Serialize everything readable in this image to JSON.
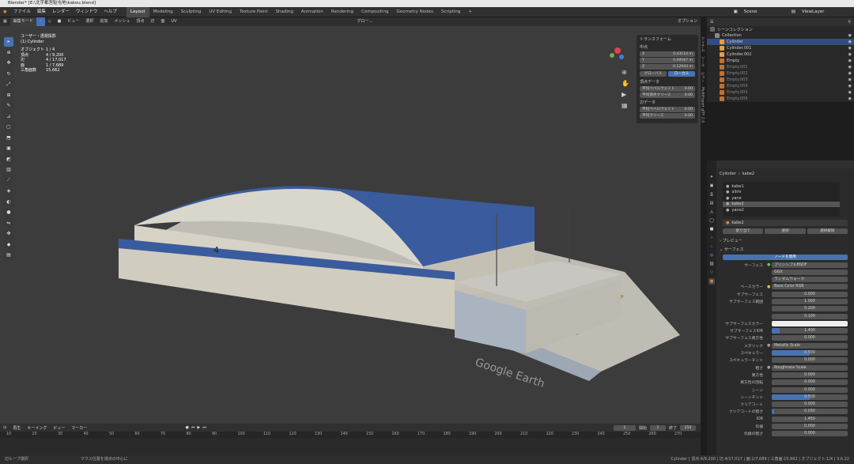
{
  "window": {
    "title": "Blender* [E:\\北宇都宮駐屯地\\kakou.blend]"
  },
  "menu": [
    "ファイル",
    "編集",
    "レンダー",
    "ウィンドウ",
    "ヘルプ"
  ],
  "workspaces": [
    "Layout",
    "Modeling",
    "Sculpting",
    "UV Editing",
    "Texture Paint",
    "Shading",
    "Animation",
    "Rendering",
    "Compositing",
    "Geometry Nodes",
    "Scripting"
  ],
  "active_workspace": "Layout",
  "scene": {
    "name": "Scene",
    "view_layer": "ViewLayer"
  },
  "viewport_header": {
    "mode": "編集モード",
    "menus": [
      "ビュー",
      "選択",
      "追加",
      "メッシュ",
      "頂点",
      "辺",
      "面",
      "UV"
    ],
    "transform": "グロー...",
    "options": "オプション"
  },
  "overlay_info": {
    "view": "ユーザー・透視投影",
    "object": "(1) Cylinder",
    "stats": [
      {
        "k": "オブジェクト",
        "v": "1 / 4"
      },
      {
        "k": "頂点",
        "v": "4 / 9,200"
      },
      {
        "k": "辺",
        "v": "4 / 17,017"
      },
      {
        "k": "面",
        "v": "1 / 7,689"
      },
      {
        "k": "三角面数",
        "v": "15,662"
      }
    ]
  },
  "n_panel": {
    "title": "トランスフォーム",
    "median": "中点",
    "x": {
      "label": "X",
      "value": "0.43114 m"
    },
    "y": {
      "label": "Y",
      "value": "0.09567 m"
    },
    "z": {
      "label": "Z",
      "value": "0.12943 m"
    },
    "global": "グローバル",
    "local": "ローカル",
    "vertex_data": "頂点データ",
    "bevel_weight_label": "平均ベベルウェイト",
    "bevel_weight": "0.00",
    "crease_label": "平均頂点クリース",
    "crease": "0.00",
    "edge_data": "辺データ",
    "edge_bevel_label": "平均ベベルウェイト",
    "edge_bevel": "0.00",
    "edge_crease_label": "平均クリース",
    "edge_crease": "0.00"
  },
  "side_tabs": [
    "アイテム",
    "ツール",
    "ビュー",
    "MultiExport glTF 2.0"
  ],
  "outliner": {
    "title": "シーンコレクション",
    "items": [
      {
        "name": "Collection",
        "color": "#888888"
      },
      {
        "name": "Cylinder",
        "color": "#e0a040"
      },
      {
        "name": "Cylinder.001",
        "color": "#e0a040"
      },
      {
        "name": "Cylinder.002",
        "color": "#e0a040"
      },
      {
        "name": "Empty",
        "color": "#c07030"
      },
      {
        "name": "Empty.001",
        "color": "#c07030"
      },
      {
        "name": "Empty.002",
        "color": "#c07030"
      },
      {
        "name": "Empty.003",
        "color": "#c07030"
      },
      {
        "name": "Empty.004",
        "color": "#c07030"
      },
      {
        "name": "Empty.005",
        "color": "#c07030"
      },
      {
        "name": "Empty.006",
        "color": "#c07030"
      }
    ]
  },
  "properties": {
    "breadcrumb_object": "Cylinder",
    "breadcrumb_material": "kabe2",
    "slots": [
      "kabe1",
      "alimi",
      "yane",
      "kabe2",
      "yane2"
    ],
    "active_slot": "kabe2",
    "material_name": "kabe2",
    "assign": "割り当て",
    "select": "選択",
    "deselect": "選択解除",
    "preview": "プレビュー",
    "surface_panel": "サーフェス",
    "use_nodes": "ノードを使用",
    "rows": [
      {
        "label": "サーフェス",
        "value": "プリンシプルBSDF",
        "dot": "#5ec35e"
      },
      {
        "label": "",
        "value": "GGX"
      },
      {
        "label": "",
        "value": "ランダムウォーク"
      },
      {
        "label": "ベースカラー",
        "value": "Base Color RGB",
        "dot": "#e0c040"
      },
      {
        "label": "サブサーフェス",
        "value": "0.000"
      },
      {
        "label": "サブサーフェス範囲",
        "value": "1.000"
      },
      {
        "label": "",
        "value": "0.200"
      },
      {
        "label": "",
        "value": "0.100"
      },
      {
        "label": "サブサーフェスカラー",
        "value": "",
        "swatch": "#eeeeee"
      },
      {
        "label": "サブサーフェスIOR",
        "value": "1.400",
        "fill": 0.1
      },
      {
        "label": "サブサーフェス異方性",
        "value": "0.000"
      },
      {
        "label": "メタリック",
        "value": "Metallic Scale",
        "dot": "#a0a0a0"
      },
      {
        "label": "スペキュラー",
        "value": "0.500",
        "fill": 0.5
      },
      {
        "label": "スペキュラーチント",
        "value": "0.000"
      },
      {
        "label": "粗さ",
        "value": "Roughness Scale",
        "dot": "#a0a0a0"
      },
      {
        "label": "異方性",
        "value": "0.000"
      },
      {
        "label": "異方性の回転",
        "value": "0.000"
      },
      {
        "label": "シーン",
        "value": "0.000"
      },
      {
        "label": "シーンチント",
        "value": "0.500",
        "fill": 0.5
      },
      {
        "label": "クリアコート",
        "value": "0.000"
      },
      {
        "label": "クリアコートの粗さ",
        "value": "0.030",
        "fill": 0.03
      },
      {
        "label": "IOR",
        "value": "1.450"
      },
      {
        "label": "伝播",
        "value": "0.000"
      },
      {
        "label": "伝播の粗さ",
        "value": "0.000"
      }
    ]
  },
  "timeline": {
    "menus": [
      "再生",
      "キーイング",
      "ビュー",
      "マーカー"
    ],
    "current_frame": "1",
    "start_label": "開始",
    "start": "1",
    "end_label": "終了",
    "end": "250",
    "ticks": [
      "10",
      "20",
      "30",
      "40",
      "50",
      "60",
      "70",
      "80",
      "90",
      "100",
      "110",
      "120",
      "130",
      "140",
      "150",
      "160",
      "170",
      "180",
      "190",
      "200",
      "210",
      "220",
      "230",
      "240",
      "250",
      "260",
      "270"
    ]
  },
  "status": {
    "left": "辺ループ選択",
    "center": "マウス位置を視点の中心に",
    "right": "Cylinder | 頂点:4/9,200 | 辺:4/17,017 | 面:1/7,689 | 三角面:15,662 | オブジェクト:1/4 | 3.6.22"
  },
  "watermark": "Google Earth",
  "building_number": "4",
  "colors": {
    "accent": "#4772b3",
    "roof": "#3a5c9e",
    "wall": "#c9c5b8"
  }
}
